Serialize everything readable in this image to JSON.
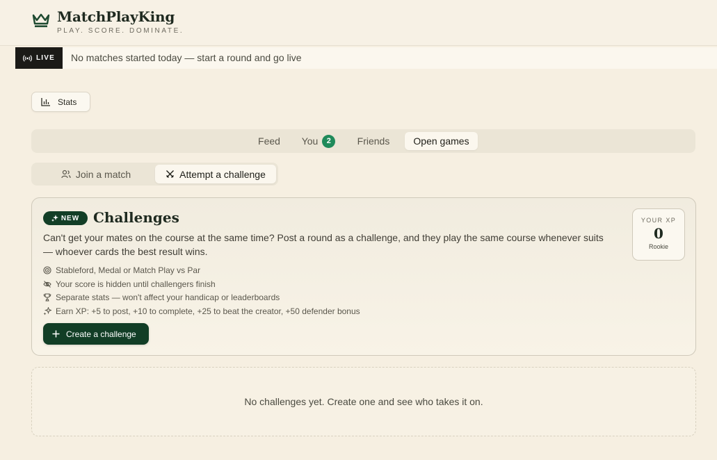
{
  "brand": {
    "name": "MatchPlayKing",
    "tagline": "PLAY. SCORE. DOMINATE."
  },
  "live": {
    "badge": "LIVE",
    "message": "No matches started today — start a round and go live"
  },
  "stats_button": {
    "label": "Stats"
  },
  "tabs": [
    {
      "label": "Feed",
      "active": false
    },
    {
      "label": "You",
      "badge": "2",
      "active": false
    },
    {
      "label": "Friends",
      "active": false
    },
    {
      "label": "Open games",
      "active": true
    }
  ],
  "subtabs": [
    {
      "label": "Join a match",
      "active": false
    },
    {
      "label": "Attempt a challenge",
      "active": true
    }
  ],
  "challenge_card": {
    "badge": "NEW",
    "title": "Challenges",
    "description": "Can't get your mates on the course at the same time? Post a round as a challenge, and they play the same course whenever suits — whoever cards the best result wins.",
    "features": [
      {
        "icon": "target-icon",
        "text": "Stableford, Medal or Match Play vs Par"
      },
      {
        "icon": "eye-off-icon",
        "text": "Your score is hidden until challengers finish"
      },
      {
        "icon": "trophy-icon",
        "text": "Separate stats — won't affect your handicap or leaderboards"
      },
      {
        "icon": "sparkles-icon",
        "text": "Earn XP: +5 to post, +10 to complete, +25 to beat the creator, +50 defender bonus"
      }
    ],
    "create_button": "Create a challenge",
    "xp": {
      "label": "YOUR XP",
      "value": "0",
      "rank": "Rookie"
    }
  },
  "empty_state": "No challenges yet. Create one and see who takes it on.",
  "colors": {
    "accent": "#123e26",
    "badge_green": "#1f8a5a",
    "background": "#f6efe1"
  }
}
